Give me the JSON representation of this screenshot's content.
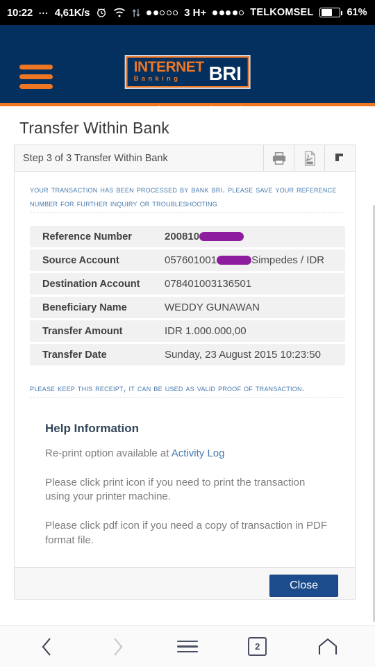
{
  "statusbar": {
    "clock": "10:22",
    "dots": "...",
    "net_speed": "4,61K/s",
    "alarm_icon": "alarm-icon",
    "wifi_icon": "wifi-icon",
    "data_arrows_icon": "data-transfer-icon",
    "sim1_signal": [
      true,
      true,
      false,
      false,
      false
    ],
    "network_type": "3 H+",
    "sim2_signal": [
      true,
      true,
      true,
      true,
      false
    ],
    "carrier": "TELKOMSEL",
    "battery_pct": "61%"
  },
  "header": {
    "menu_icon": "hamburger-menu-icon",
    "logo": {
      "internet": "INTERNET",
      "banking": "Banking",
      "bri": "BRI"
    },
    "nav": [
      {
        "label": "Home",
        "strong": false
      },
      {
        "label": "Inbox",
        "strong": false
      },
      {
        "label": "Help",
        "strong": false
      },
      {
        "label": "Logout",
        "strong": true
      }
    ],
    "separator": "|",
    "brand_blue": "#03305e",
    "brand_orange": "#ef7622",
    "nav_link_color": "#e9a93a"
  },
  "page": {
    "title": "Transfer Within Bank"
  },
  "panel": {
    "step_title": "Step 3 of 3 Transfer Within Bank",
    "toolbar": [
      {
        "name": "print-icon",
        "label": "Print"
      },
      {
        "name": "pdf-icon",
        "label": "PDF"
      },
      {
        "name": "collapse-corner-icon",
        "label": "Collapse"
      }
    ],
    "notice_top": "Your transaction has been processed by Bank BRI. Please save your Reference Number for further inquiry or troubleshooting",
    "notice_bottom": "Please keep this receipt, it can be used as valid proof of transaction.",
    "rows": [
      {
        "key": "Reference Number",
        "value": "200810",
        "redacted": true,
        "bold": true
      },
      {
        "key": "Source Account",
        "value": "057601001",
        "redacted": true,
        "value_suffix": "Simpedes / IDR"
      },
      {
        "key": "Destination Account",
        "value": "078401003136501"
      },
      {
        "key": "Beneficiary Name",
        "value": "WEDDY GUNAWAN"
      },
      {
        "key": "Transfer Amount",
        "value": "IDR 1.000.000,00"
      },
      {
        "key": "Transfer Date",
        "value": "Sunday, 23 August 2015 10:23:50"
      }
    ],
    "redaction_color": "#8e1c9e",
    "help_heading": "Help Information",
    "help_reprint_prefix": "Re-print option available at ",
    "help_reprint_link": "Activity Log",
    "help_p1": "Please click print icon if you need to print the transaction using your printer machine.",
    "help_p2": "Please click pdf icon if you need a copy of transaction in PDF format file.",
    "close_label": "Close"
  },
  "bottombar": {
    "back_icon": "chevron-left-icon",
    "forward_icon": "chevron-right-icon",
    "menu_icon": "menu-bars-icon",
    "tab_count": "2",
    "home_icon": "home-icon"
  }
}
